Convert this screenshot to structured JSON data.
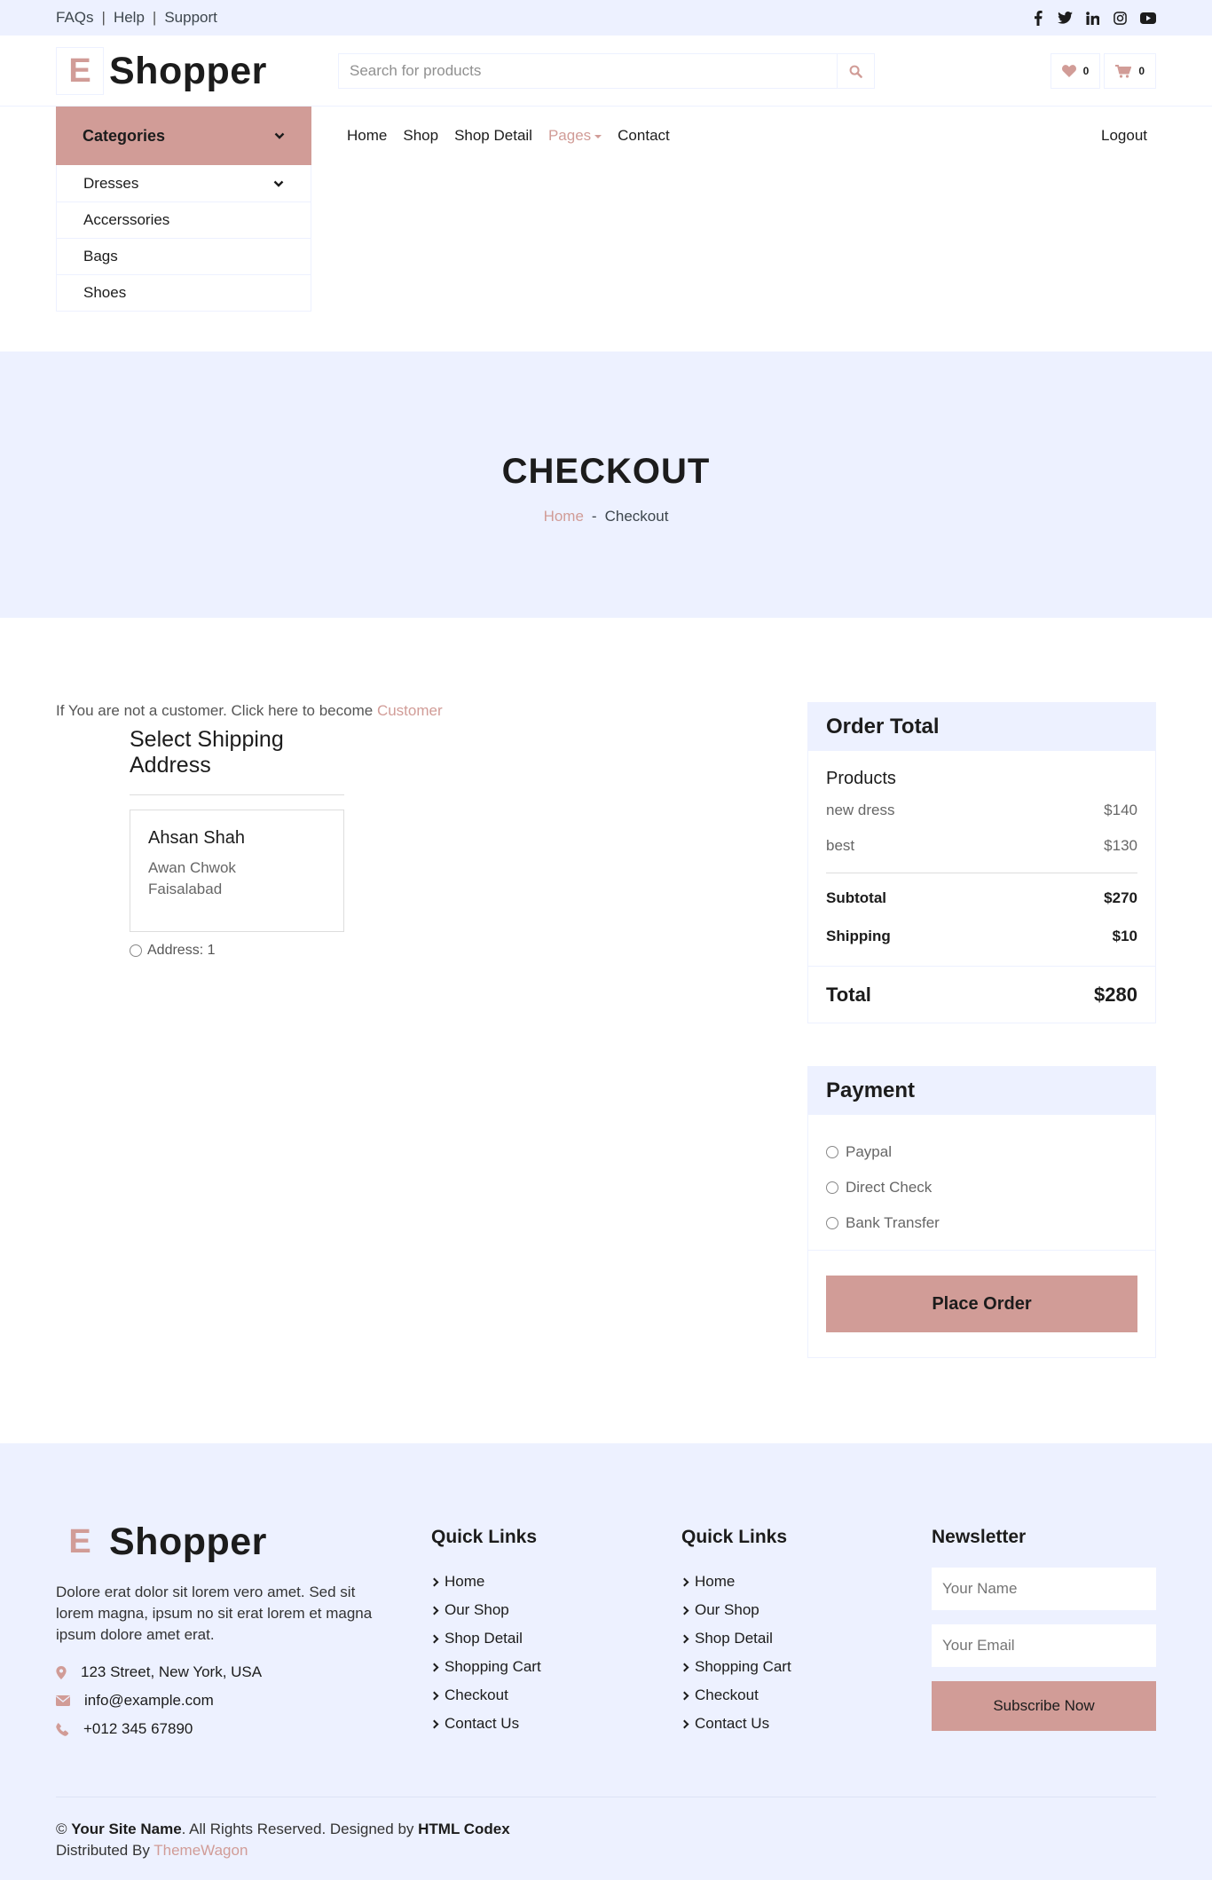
{
  "topbar": {
    "links": [
      "FAQs",
      "Help",
      "Support"
    ],
    "social_icons": [
      "facebook-icon",
      "twitter-icon",
      "linkedin-icon",
      "instagram-icon",
      "youtube-icon"
    ]
  },
  "header": {
    "logo_letter": "E",
    "logo_text": "Shopper",
    "search_placeholder": "Search for products",
    "wishlist_count": "0",
    "cart_count": "0"
  },
  "categories": {
    "title": "Categories",
    "items": [
      "Dresses",
      "Accerssories",
      "Bags",
      "Shoes"
    ]
  },
  "nav": {
    "items": [
      "Home",
      "Shop",
      "Shop Detail",
      "Pages",
      "Contact"
    ],
    "active": "Pages",
    "logout": "Logout"
  },
  "page_header": {
    "title": "CHECKOUT",
    "crumb_home": "Home",
    "crumb_sep": "-",
    "crumb_current": "Checkout"
  },
  "checkout": {
    "notice_text": "If You are not a customer. Click here to become",
    "notice_link": "Customer",
    "address_title": "Select Shipping Address",
    "address": {
      "name": "Ahsan Shah",
      "line1": "Awan Chwok",
      "line2": "Faisalabad",
      "radio_label": "Address: 1"
    }
  },
  "order_total": {
    "title": "Order Total",
    "products_label": "Products",
    "products": [
      {
        "name": "new dress",
        "price": "$140"
      },
      {
        "name": "best",
        "price": "$130"
      }
    ],
    "subtotal_label": "Subtotal",
    "subtotal": "$270",
    "shipping_label": "Shipping",
    "shipping": "$10",
    "total_label": "Total",
    "total": "$280"
  },
  "payment": {
    "title": "Payment",
    "options": [
      "Paypal",
      "Direct Check",
      "Bank Transfer"
    ],
    "button": "Place Order"
  },
  "footer": {
    "logo_letter": "E",
    "logo_text": "Shopper",
    "description": "Dolore erat dolor sit lorem vero amet. Sed sit lorem magna, ipsum no sit erat lorem et magna ipsum dolore amet erat.",
    "address": "123 Street, New York, USA",
    "email": "info@example.com",
    "phone": "+012 345 67890",
    "quick_links_title_1": "Quick Links",
    "quick_links_title_2": "Quick Links",
    "quick_links": [
      "Home",
      "Our Shop",
      "Shop Detail",
      "Shopping Cart",
      "Checkout",
      "Contact Us"
    ],
    "newsletter_title": "Newsletter",
    "name_placeholder": "Your Name",
    "email_placeholder": "Your Email",
    "subscribe": "Subscribe Now",
    "copy_symbol": "©",
    "site_name": "Your Site Name",
    "rights": ". All Rights Reserved. Designed by",
    "designer": "HTML Codex",
    "distributed": "Distributed By",
    "distributor": "ThemeWagon"
  },
  "colors": {
    "primary": "#d19c97",
    "secondary": "#edf1ff",
    "dark": "#1c1c1c"
  }
}
